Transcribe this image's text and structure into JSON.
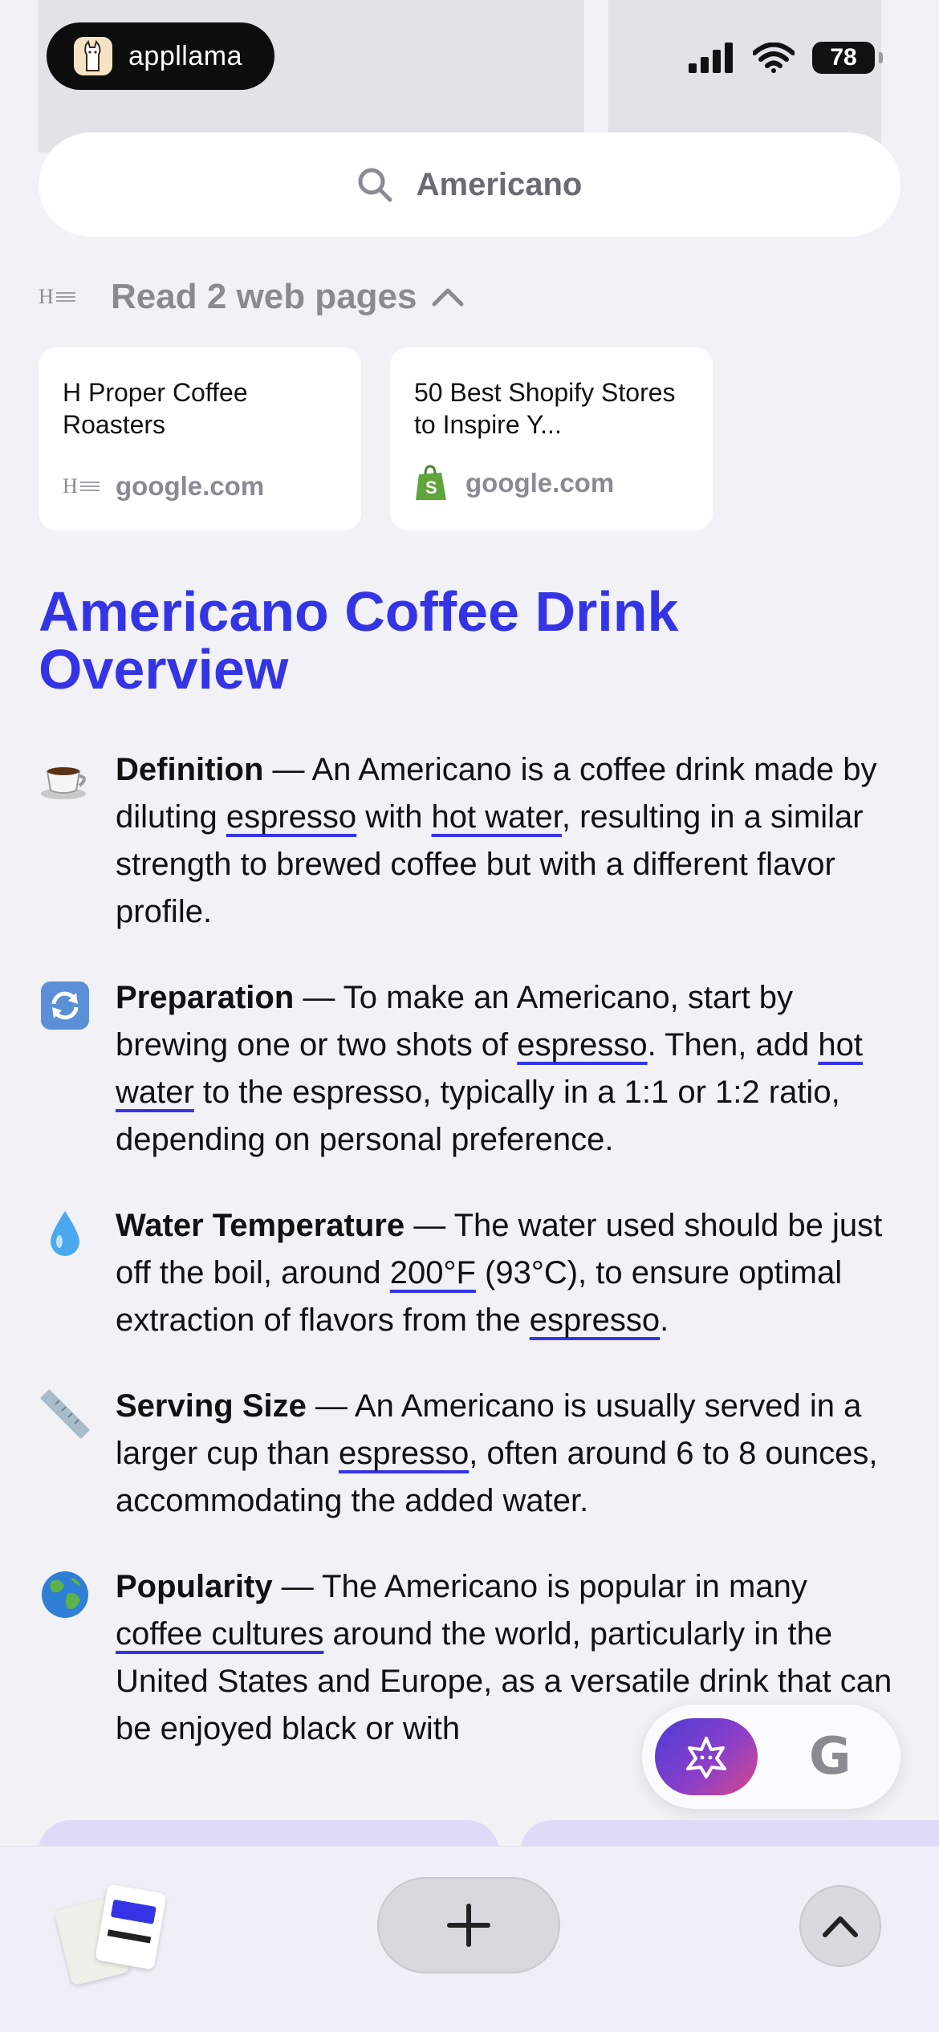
{
  "brand": {
    "name": "appllama",
    "logo_icon": "llama-icon"
  },
  "status_bar": {
    "battery": "78",
    "signal_icon": "cellular-signal-icon",
    "wifi_icon": "wifi-icon"
  },
  "search": {
    "query": "Americano",
    "icon": "search-icon"
  },
  "sources": {
    "header": "Read 2 web pages",
    "toggle_icon": "chevron-up-icon",
    "cards": [
      {
        "title": "H Proper Coffee Roasters",
        "domain": "google.com",
        "favicon": "h-proper-logo-icon"
      },
      {
        "title": "50 Best Shopify Stores to Inspire Y...",
        "domain": "google.com",
        "favicon": "shopify-bag-icon"
      }
    ]
  },
  "answer": {
    "title": "Americano Coffee Drink Overview",
    "bullets": [
      {
        "emoji": "coffee-cup-icon",
        "heading": "Definition",
        "parts": [
          " — An Americano is a coffee drink made by diluting ",
          "espresso",
          " with ",
          "hot water",
          ", resulting in a similar strength to brewed coffee but with a different flavor profile."
        ]
      },
      {
        "emoji": "arrows-cycle-icon",
        "heading": "Preparation",
        "parts": [
          " — To make an Americano, start by brewing one or two shots of ",
          "espresso",
          ". Then, add ",
          "hot water",
          " to the espresso, typically in a 1:1 or 1:2 ratio, depending on personal preference."
        ]
      },
      {
        "emoji": "droplet-icon",
        "heading": "Water Temperature",
        "parts": [
          " — The water used should be just off the boil, around ",
          "200°F",
          " (93°C), to ensure optimal extraction of flavors from the ",
          "espresso",
          "."
        ]
      },
      {
        "emoji": "ruler-icon",
        "heading": "Serving Size",
        "parts": [
          " — An Americano is usually served in a larger cup than ",
          "espresso",
          ", often around 6 to 8 ounces, accommodating the added water."
        ]
      },
      {
        "emoji": "globe-icon",
        "heading": "Popularity",
        "parts": [
          " — The Americano is popular in many ",
          "coffee cultures",
          " around the world, particularly in the United States and Europe, as a versatile drink that can be enjoyed black or with"
        ]
      }
    ]
  },
  "floating_actions": {
    "ai_icon": "ai-llama-icon",
    "google_label": "G"
  },
  "bottom_bar": {
    "tabs_icon": "tab-thumbnails-icon",
    "new_tab_icon": "plus-icon",
    "scroll_top_icon": "chevron-up-icon"
  },
  "colors": {
    "accent": "#3434e6",
    "background": "#f1f1f6"
  }
}
